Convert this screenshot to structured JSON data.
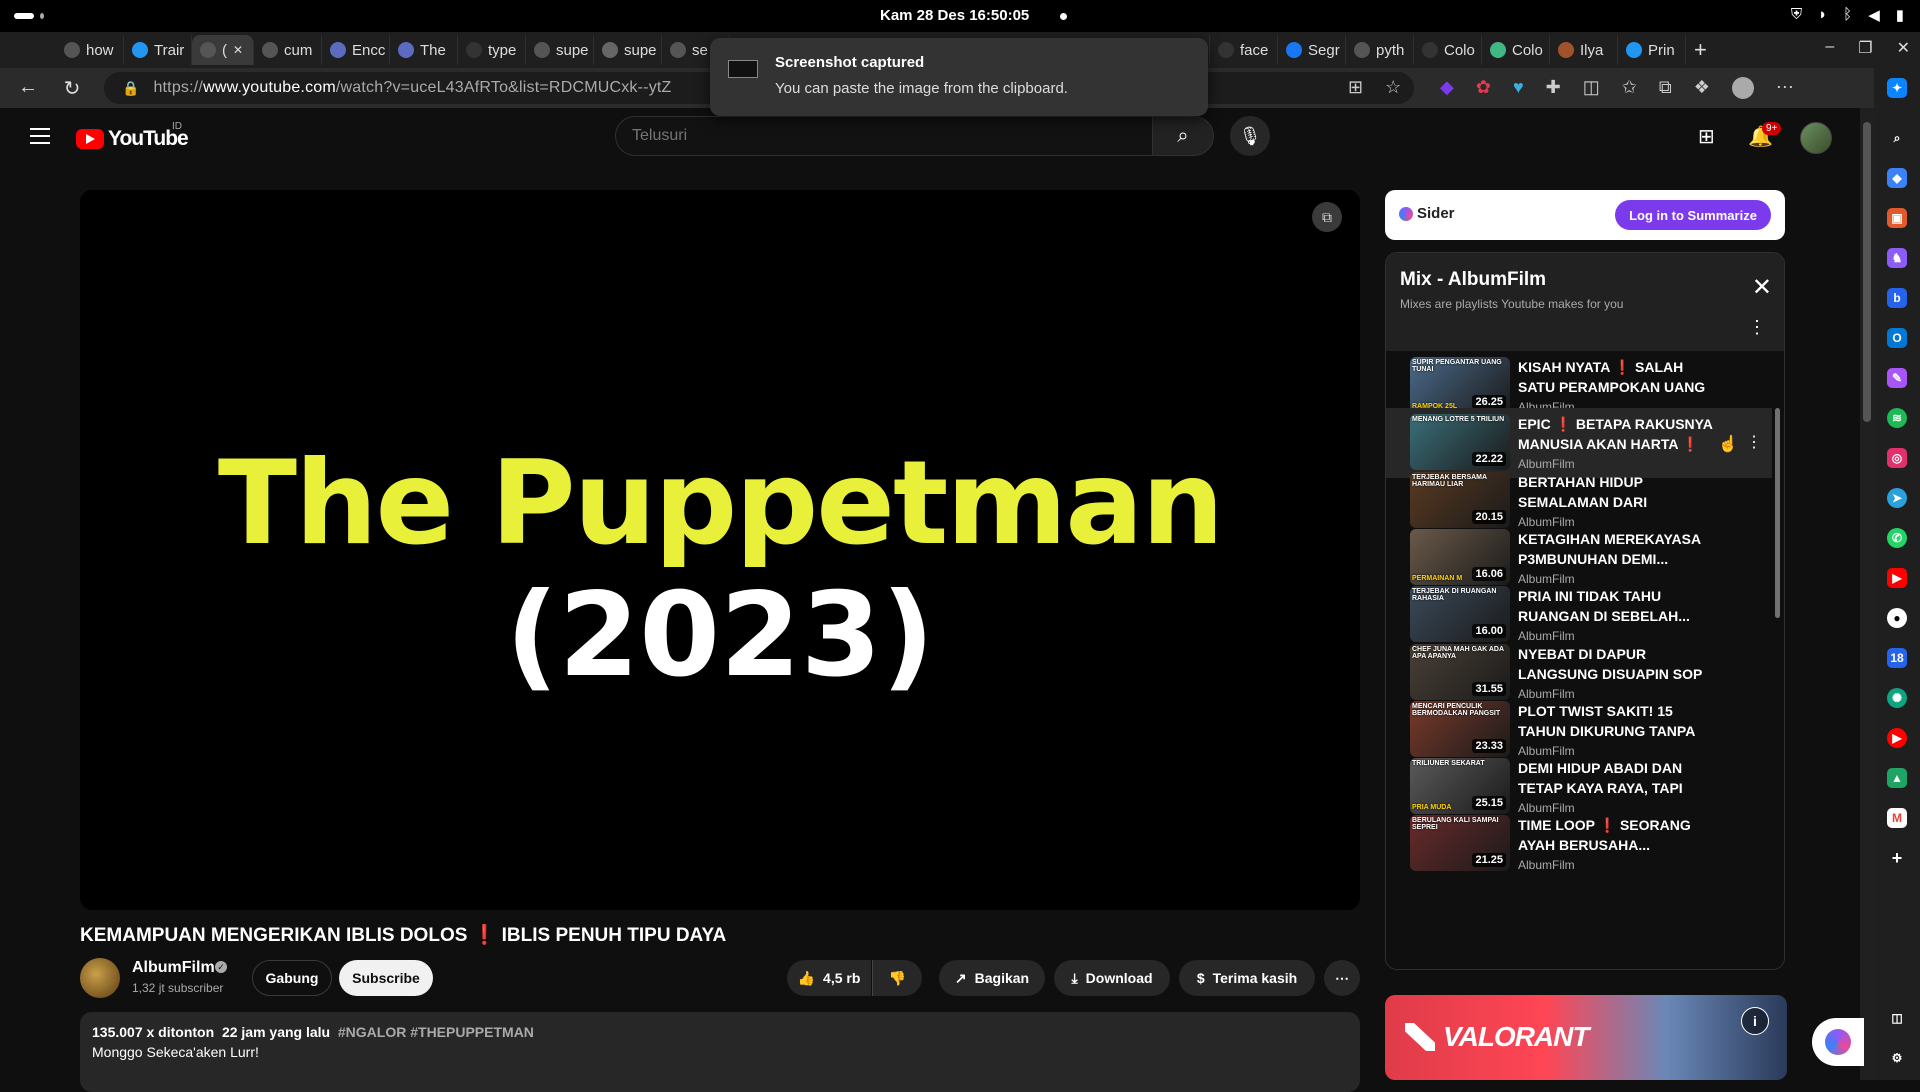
{
  "os": {
    "clock": "Kam 28 Des  16:50:05",
    "tray_icons": [
      "shield-icon",
      "wifi-icon",
      "bluetooth-icon",
      "volume-icon",
      "battery-icon"
    ]
  },
  "tabs": [
    {
      "label": "how",
      "icon": "search-icon",
      "color": "#555555"
    },
    {
      "label": "Trair",
      "icon": "flutter-icon",
      "color": "#2196f3"
    },
    {
      "label": "(",
      "icon": "audio-icon",
      "color": "#555555",
      "active": true
    },
    {
      "label": "cum",
      "icon": "search-icon",
      "color": "#555555"
    },
    {
      "label": "Encc",
      "icon": "web-icon",
      "color": "#5c6bc0"
    },
    {
      "label": "The",
      "icon": "web-icon",
      "color": "#5c6bc0"
    },
    {
      "label": "type",
      "icon": "github-icon",
      "color": "#333333"
    },
    {
      "label": "supe",
      "icon": "search-icon",
      "color": "#555555"
    },
    {
      "label": "supe",
      "icon": "web-icon",
      "color": "#666666"
    },
    {
      "label": "se",
      "icon": "search-icon",
      "color": "#555555"
    }
  ],
  "tabs_right": [
    {
      "label": "face",
      "icon": "github-icon",
      "color": "#333333"
    },
    {
      "label": "face",
      "icon": "github-icon",
      "color": "#333333"
    },
    {
      "label": "Segr",
      "icon": "meta-icon",
      "color": "#1877f2"
    },
    {
      "label": "pyth",
      "icon": "search-icon",
      "color": "#555555"
    },
    {
      "label": "Colo",
      "icon": "web-icon",
      "color": "#333333"
    },
    {
      "label": "Colo",
      "icon": "vue-icon",
      "color": "#41b883"
    },
    {
      "label": "Ilya",
      "icon": "avatar-icon",
      "color": "#a0522d"
    },
    {
      "label": "Prin",
      "icon": "web-icon",
      "color": "#2196f3"
    }
  ],
  "address": {
    "scheme": "https://",
    "host": "www.youtube.com",
    "path": "/watch?v=uceL43AfRTo&list=RDCMUCxk--ytZ"
  },
  "toast": {
    "title": "Screenshot captured",
    "body": "You can paste the image from the clipboard."
  },
  "youtube": {
    "logo_text": "YouTube",
    "region": "ID",
    "search_placeholder": "Telusuri",
    "notification_count": "9+"
  },
  "player": {
    "title_line1": "The Puppetman",
    "title_line2": "(2023)"
  },
  "video": {
    "title_part1": "KEMAMPUAN MENGERIKAN IBLIS DOLOS",
    "title_mark": "❗",
    "title_part2": " IBLIS PENUH TIPU DAYA",
    "channel": "AlbumFilm",
    "subscribers": "1,32 jt subscriber",
    "join_label": "Gabung",
    "subscribe_label": "Subscribe",
    "likes": "4,5 rb",
    "share_label": "Bagikan",
    "download_label": "Download",
    "thanks_label": "Terima kasih",
    "views": "135.007 x ditonton",
    "posted": "22 jam yang lalu",
    "tags": "#NGALOR #THEPUPPETMAN",
    "description": "Monggo Sekeca'aken Lurr!"
  },
  "sider": {
    "logo": "Sider",
    "button": "Log in to Summarize"
  },
  "mix": {
    "title": "Mix - AlbumFilm",
    "subtitle": "Mixes are playlists Youtube makes for you",
    "items": [
      {
        "title": "KISAH NYATA ❗ SALAH SATU PERAMPOKAN UANG TUNAI...",
        "channel": "AlbumFilm",
        "duration": "26.25",
        "cap": "SUPIR PENGANTAR UANG TUNAI",
        "cap2": "RAMPOK 25L",
        "bg": "#4a6b8a"
      },
      {
        "title": "EPIC ❗ BETAPA RAKUSNYA MANUSIA AKAN HARTA ❗",
        "channel": "AlbumFilm",
        "duration": "22.22",
        "cap": "MENANG LOTRE 5 TRILIUN",
        "cap2": "",
        "bg": "#3a6f7a"
      },
      {
        "title": "BERTAHAN HIDUP SEMALAMAN DARI HARIMA...",
        "channel": "AlbumFilm",
        "duration": "20.15",
        "cap": "TERJEBAK BERSAMA HARIMAU LIAR",
        "cap2": "",
        "bg": "#5a3a22"
      },
      {
        "title": "KETAGIHAN MEREKAYASA P3MBUNUHAN DEMI...",
        "channel": "AlbumFilm",
        "duration": "16.06",
        "cap": "",
        "cap2": "PERMAINAN M",
        "bg": "#6a5a4a"
      },
      {
        "title": "PRIA INI TIDAK TAHU RUANGAN DI SEBELAH...",
        "channel": "AlbumFilm",
        "duration": "16.00",
        "cap": "TERJEBAK DI RUANGAN RAHASIA",
        "cap2": "",
        "bg": "#3a4a5a"
      },
      {
        "title": "NYEBAT DI DAPUR LANGSUNG DISUAPIN SOP PUNTUNG...",
        "channel": "AlbumFilm",
        "duration": "31.55",
        "cap": "CHEF JUNA MAH GAK ADA APA APANYA",
        "cap2": "",
        "bg": "#4a4036"
      },
      {
        "title": "PLOT TWIST SAKIT! 15 TAHUN DIKURUNG TANPA ALASAN...",
        "channel": "AlbumFilm",
        "duration": "23.33",
        "cap": "MENCARI PENCULIK BERMODALKAN PANGSIT",
        "cap2": "",
        "bg": "#7a3a2a"
      },
      {
        "title": "DEMI HIDUP ABADI DAN TETAP KAYA RAYA, TAPI ADA...",
        "channel": "AlbumFilm",
        "duration": "25.15",
        "cap": "TRILIUNER SEKARAT",
        "cap2": "PRIA MUDA",
        "bg": "#5a5a5a"
      },
      {
        "title": "TIME LOOP ❗ SEORANG AYAH BERUSAHA...",
        "channel": "AlbumFilm",
        "duration": "21.25",
        "cap": "BERULANG KALI SAMPAI SEPREI",
        "cap2": "",
        "bg": "#6a2a2a"
      }
    ]
  },
  "ad": {
    "brand": "VALORANT"
  }
}
